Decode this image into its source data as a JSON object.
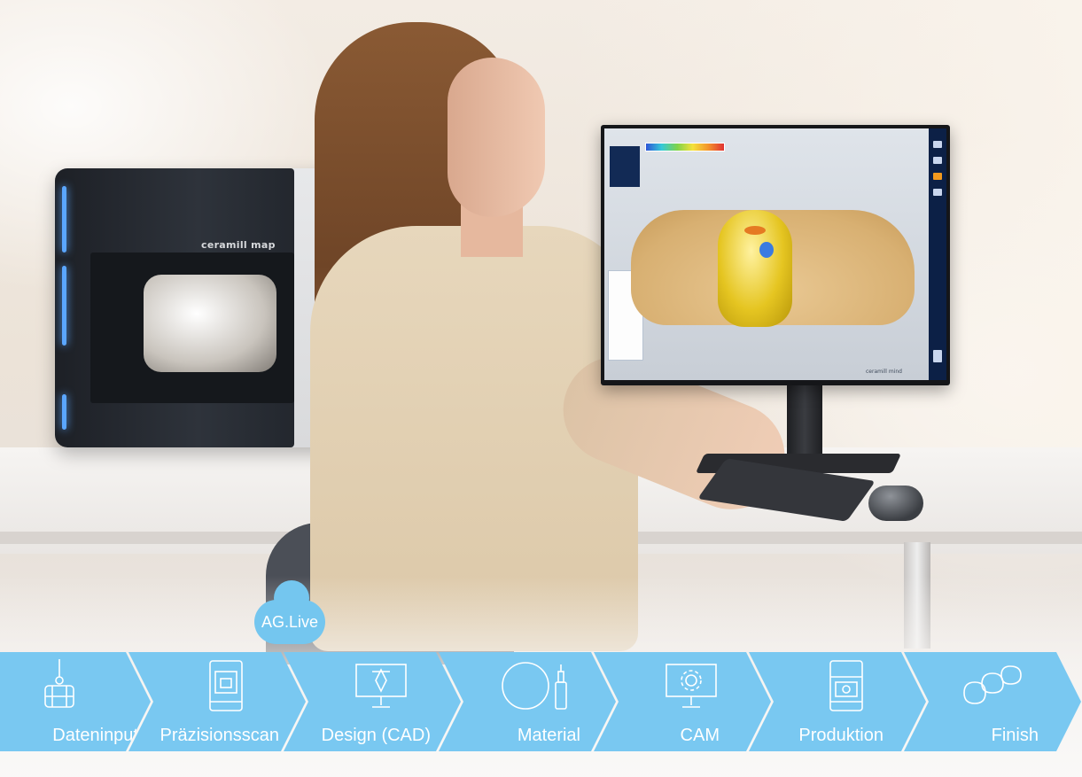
{
  "cloud": {
    "label": "AG.Live"
  },
  "scanner": {
    "brand_label": "ceramill map"
  },
  "monitor": {
    "screen_brand": "ceramill mind"
  },
  "process": {
    "steps": [
      {
        "label": "Dateninput",
        "icon": "articulator-icon"
      },
      {
        "label": "Präzisionsscan",
        "icon": "scanner-icon"
      },
      {
        "label": "Design (CAD)",
        "icon": "cad-monitor-icon"
      },
      {
        "label": "Material",
        "icon": "material-disc-icon"
      },
      {
        "label": "CAM",
        "icon": "cam-monitor-icon"
      },
      {
        "label": "Produktion",
        "icon": "milling-machine-icon"
      },
      {
        "label": "Finish",
        "icon": "crowns-icon"
      }
    ]
  },
  "colors": {
    "chevron": "#79c8f1",
    "text": "#ffffff"
  }
}
